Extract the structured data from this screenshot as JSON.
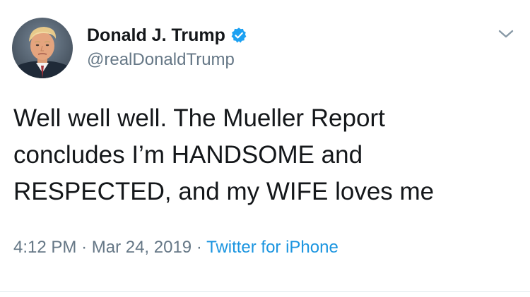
{
  "tweet": {
    "author": {
      "display_name": "Donald J. Trump",
      "handle": "@realDonaldTrump",
      "verified": true,
      "avatar_icon": "profile-photo"
    },
    "text_lines": [
      "Well well well. The Mueller Report",
      "concludes I’m HANDSOME and",
      "RESPECTED, and my WIFE loves me"
    ],
    "time": "4:12 PM",
    "date": "Mar 24, 2019",
    "separator": "·",
    "source": "Twitter for iPhone",
    "menu_icon": "chevron-down-icon"
  },
  "colors": {
    "text_primary": "#14171a",
    "text_secondary": "#657786",
    "link": "#1b95e0",
    "verified_badge": "#1da1f2"
  }
}
